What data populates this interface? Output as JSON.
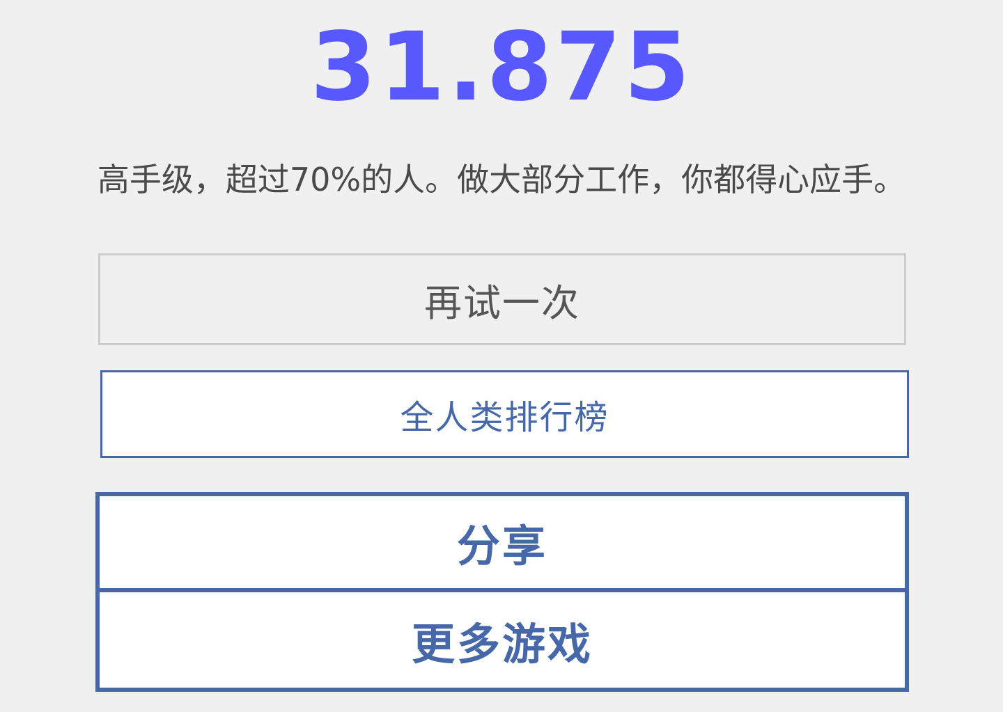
{
  "result": {
    "score": "31.875",
    "description": "高手级，超过70%的人。做大部分工作，你都得心应手。"
  },
  "actions": {
    "retry_label": "再试一次",
    "leaderboard_label": "全人类排行榜",
    "share_label": "分享",
    "more_games_label": "更多游戏"
  },
  "colors": {
    "score": "#5858ff",
    "accent": "#4668a8",
    "background": "#f0f0f0"
  }
}
